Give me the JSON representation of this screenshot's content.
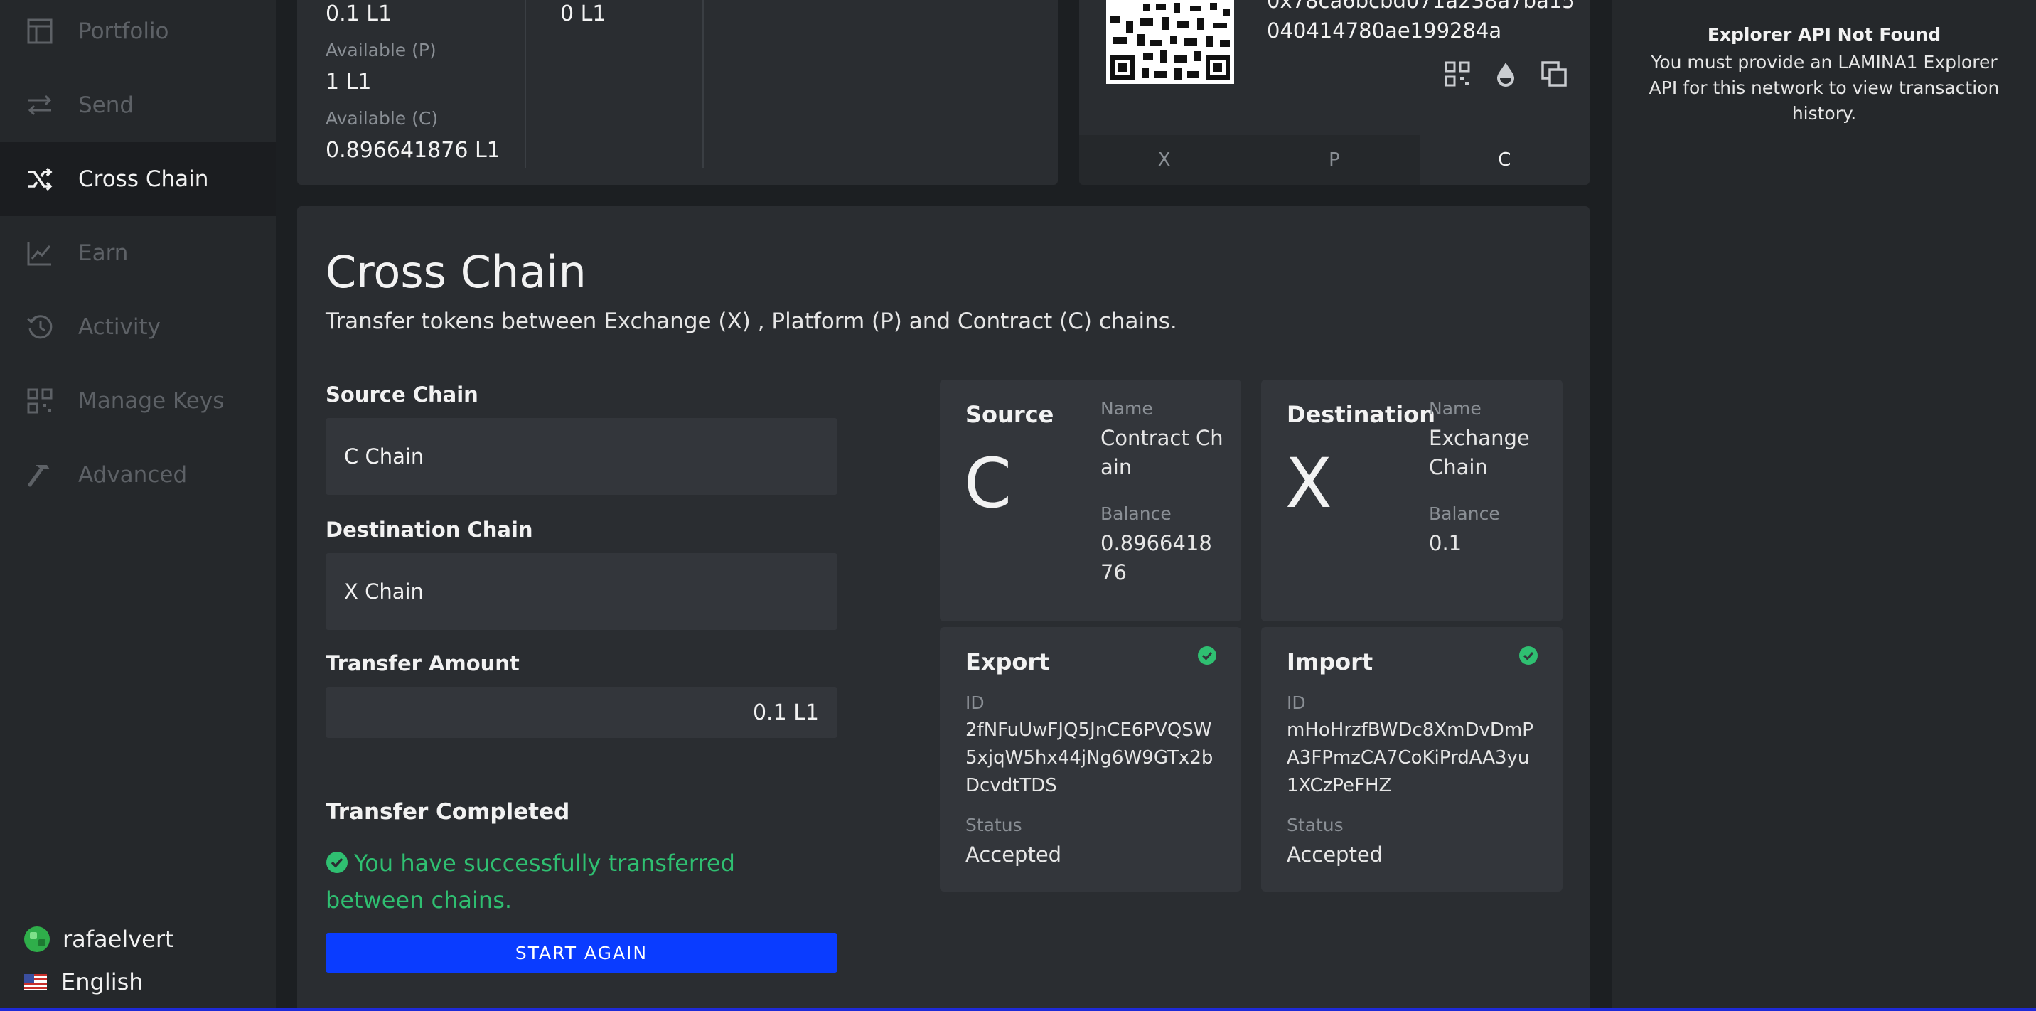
{
  "sidebar": {
    "items": [
      {
        "label": "Portfolio",
        "icon": "portfolio-icon"
      },
      {
        "label": "Send",
        "icon": "send-arrows-icon"
      },
      {
        "label": "Cross Chain",
        "icon": "shuffle-icon"
      },
      {
        "label": "Earn",
        "icon": "chart-line-icon"
      },
      {
        "label": "Activity",
        "icon": "history-icon"
      },
      {
        "label": "Manage Keys",
        "icon": "qr-keys-icon"
      },
      {
        "label": "Advanced",
        "icon": "hammer-icon"
      }
    ],
    "active": "Cross Chain",
    "user": "rafaelvert",
    "language": "English"
  },
  "balance": {
    "col1_top_value": "0.1 L1",
    "available_p_label": "Available (P)",
    "available_p_value": "1 L1",
    "available_c_label": "Available (C)",
    "available_c_value": "0.896641876 L1",
    "col2_top_value": "0 L1"
  },
  "address": {
    "line1": "0x78ca6bcbd071a238a7ba15",
    "line2": "040414780ae199284a",
    "tabs": [
      "X",
      "P",
      "C"
    ],
    "active_tab": "C"
  },
  "cross_chain": {
    "title": "Cross Chain",
    "subtitle": "Transfer tokens between Exchange (X) , Platform (P) and Contract (C) chains.",
    "source_label": "Source Chain",
    "source_value": "C Chain",
    "destination_label": "Destination Chain",
    "destination_value": "X Chain",
    "amount_label": "Transfer Amount",
    "amount_value": "0.1 L1",
    "completed_title": "Transfer Completed",
    "success_message": "You have successfully transferred between chains.",
    "start_again": "START AGAIN"
  },
  "source_box": {
    "heading": "Source",
    "letter": "C",
    "name_label": "Name",
    "name_value": "Contract Chain",
    "balance_label": "Balance",
    "balance_value": "0.896641876"
  },
  "destination_box": {
    "heading": "Destination",
    "letter": "X",
    "name_label": "Name",
    "name_value": "Exchange Chain",
    "balance_label": "Balance",
    "balance_value": "0.1"
  },
  "export_box": {
    "heading": "Export",
    "id_label": "ID",
    "id_value": "2fNFuUwFJQ5JnCE6PVQSW5xjqW5hx44jNg6W9GTx2bDcvdtTDS",
    "status_label": "Status",
    "status_value": "Accepted"
  },
  "import_box": {
    "heading": "Import",
    "id_label": "ID",
    "id_value": "mHoHrzfBWDc8XmDvDmPA3FPmzCA7CoKiPrdAA3yu1XCzPeFHZ",
    "status_label": "Status",
    "status_value": "Accepted"
  },
  "right_panel": {
    "title": "Explorer API Not Found",
    "message": "You must provide an LAMINA1 Explorer API for this network to view transaction history."
  },
  "colors": {
    "accent_blue": "#0a3cff",
    "success_green": "#2fbf71",
    "background": "#1c1f22",
    "panel": "#2a2d31"
  }
}
